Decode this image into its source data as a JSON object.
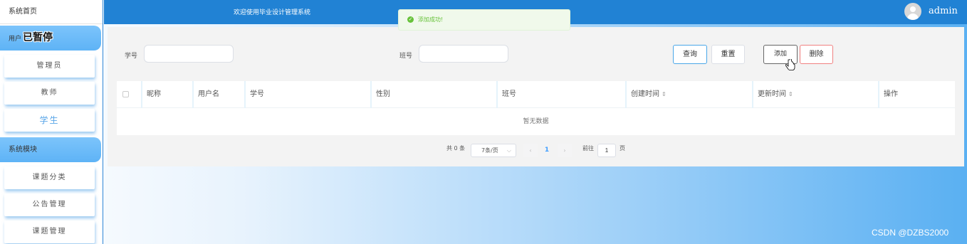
{
  "sidebar": {
    "home": "系统首页",
    "group_user": {
      "prefix": "用户",
      "overlay": "已暂停"
    },
    "user_items": [
      "管理员",
      "教师",
      "学生"
    ],
    "group_system": "系统模块",
    "system_items": [
      "课题分类",
      "公告管理",
      "课题管理"
    ]
  },
  "header": {
    "welcome": "欢迎使用毕业设计管理系统",
    "username": "admin"
  },
  "toast": {
    "message": "添加成功!"
  },
  "filters": {
    "student_no_label": "学号",
    "student_no_value": "",
    "class_no_label": "班号",
    "class_no_value": ""
  },
  "buttons": {
    "query": "查询",
    "reset": "重置",
    "add": "添加",
    "delete": "删除"
  },
  "table": {
    "columns": [
      "昵称",
      "用户名",
      "学号",
      "性别",
      "班号",
      "创建时间",
      "更新时间",
      "操作"
    ],
    "empty_text": "暂无数据"
  },
  "pagination": {
    "total": "共 0 条",
    "page_size": "7条/页",
    "current_page": "1",
    "goto_label": "前往",
    "goto_value": "1",
    "page_suffix": "页"
  },
  "watermark": "CSDN @DZBS2000",
  "colors": {
    "header": "#2182d4",
    "sidebar_active": "#5eb3f6",
    "success": "#67c23a",
    "primary": "#409eff"
  }
}
